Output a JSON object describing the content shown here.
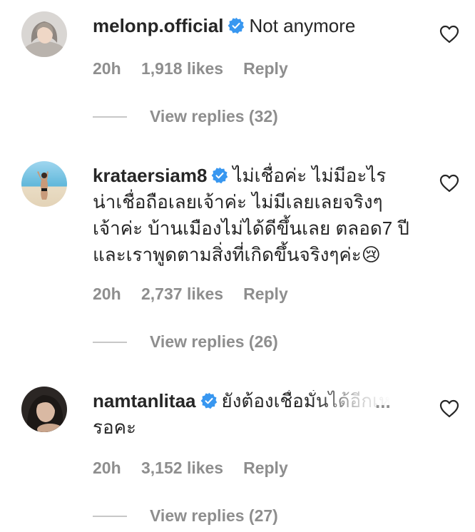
{
  "comments": [
    {
      "username": "melonp.official",
      "text": "Not anymore",
      "time": "20h",
      "likes": "1,918 likes",
      "reply": "Reply",
      "view_replies": "View replies (32)"
    },
    {
      "username": "krataersiam8",
      "text_lines": [
        "ไม่เชื่อค่ะ ไม่มีอะไร",
        "น่าเชื่อถือเลยเจ้าค่ะ ไม่มีเลยเลยจริงๆ",
        "เจ้าค่ะ บ้านเมืองไม่ได้ดีขึ้นเลย ตลอด7 ปี",
        "และเราพูดตามสิ่งที่เกิดขึ้นจริงๆค่ะ😢"
      ],
      "time": "20h",
      "likes": "2,737 likes",
      "reply": "Reply",
      "view_replies": "View replies (26)"
    },
    {
      "username": "namtanlitaa",
      "text_lines": [
        "ยังต้องเชื่อมั่นได้อีกเห",
        "รอคะ"
      ],
      "more": "...",
      "time": "20h",
      "likes": "3,152 likes",
      "reply": "Reply",
      "view_replies": "View replies (27)"
    }
  ],
  "icons": {
    "verified": "verified-badge-icon",
    "like": "heart-outline-icon"
  },
  "colors": {
    "verified_blue": "#3897f0",
    "secondary_text": "#8e8e8e",
    "primary_text": "#262626"
  }
}
